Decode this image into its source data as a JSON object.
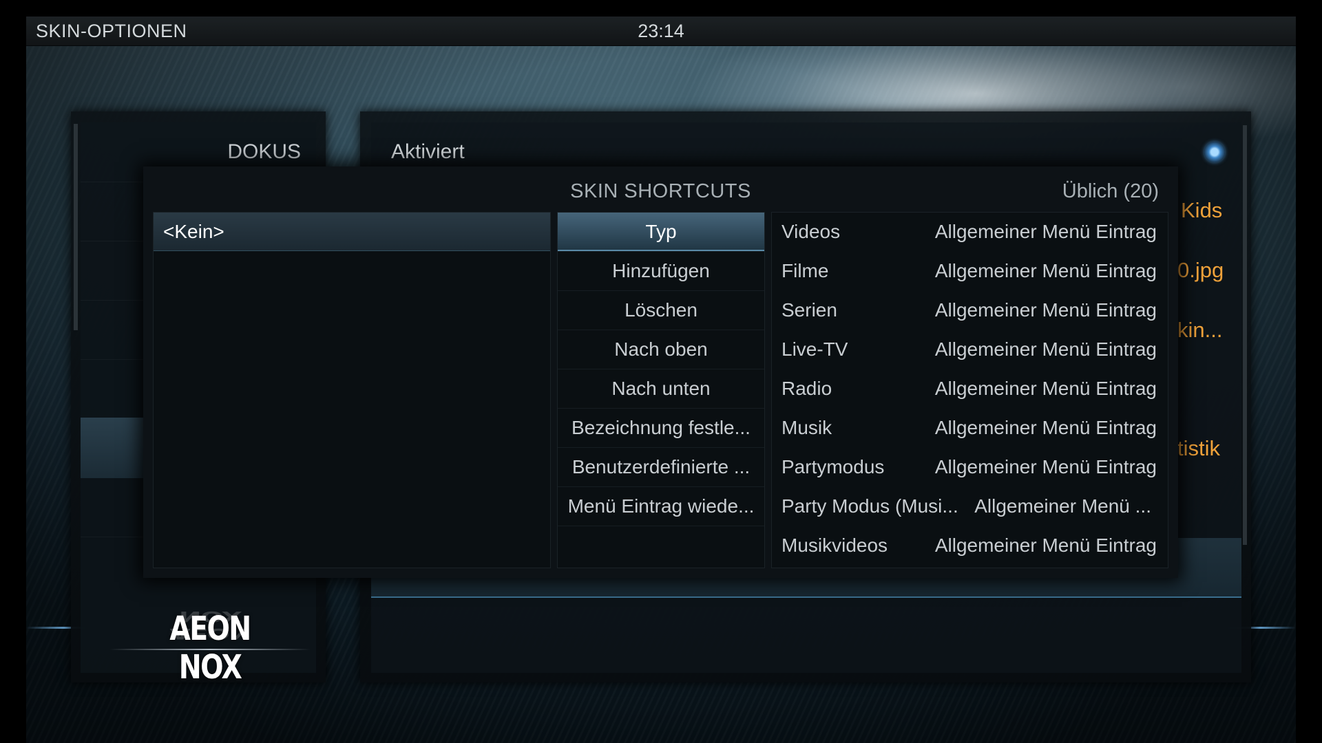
{
  "topbar": {
    "title": "SKIN-OPTIONEN",
    "clock": "23:14"
  },
  "left_menu": {
    "current_item": "DOKUS",
    "logo_text": "AEON NOX"
  },
  "settings": {
    "aktiviert_label": "Aktiviert",
    "aktiviert_on": true,
    "partial_values": [
      "Kids",
      "0.jpg",
      "kin...",
      "tistik"
    ]
  },
  "dialog": {
    "title": "SKIN SHORTCUTS",
    "count_label": "Üblich (20)",
    "selected_shortcut": "<Kein>",
    "actions": [
      "Typ",
      "Hinzufügen",
      "Löschen",
      "Nach oben",
      "Nach unten",
      "Bezeichnung festle...",
      "Benutzerdefinierte ...",
      "Menü Eintrag wiede..."
    ],
    "items": [
      {
        "name": "Videos",
        "type": "Allgemeiner Menü Eintrag"
      },
      {
        "name": "Filme",
        "type": "Allgemeiner Menü Eintrag"
      },
      {
        "name": "Serien",
        "type": "Allgemeiner Menü Eintrag"
      },
      {
        "name": "Live-TV",
        "type": "Allgemeiner Menü Eintrag"
      },
      {
        "name": "Radio",
        "type": "Allgemeiner Menü Eintrag"
      },
      {
        "name": "Musik",
        "type": "Allgemeiner Menü Eintrag"
      },
      {
        "name": "Partymodus",
        "type": "Allgemeiner Menü Eintrag"
      },
      {
        "name": "Party Modus (Musi...",
        "type": "Allgemeiner Menü ..."
      },
      {
        "name": "Musikvideos",
        "type": "Allgemeiner Menü Eintrag"
      }
    ]
  },
  "colors": {
    "accent_orange": "#f0a23a",
    "radio_blue": "#3e86c8"
  }
}
